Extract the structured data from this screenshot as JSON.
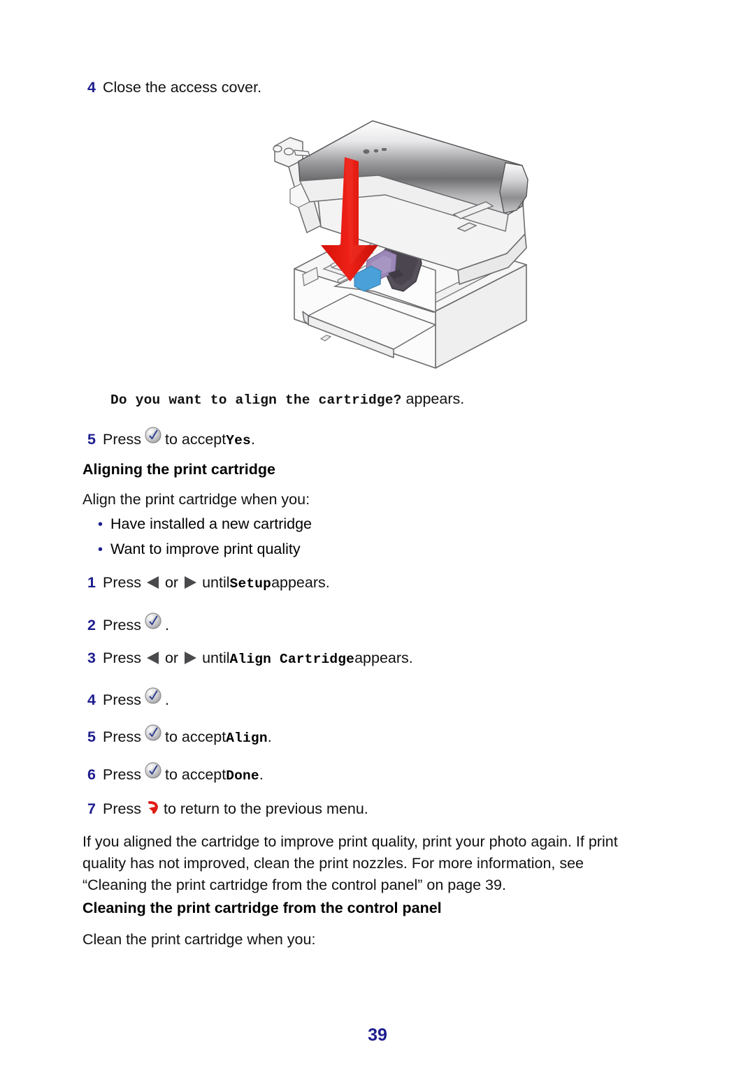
{
  "document": {
    "page_number": "39",
    "page_background": "#ffffff",
    "accent_color": "#1d1d8f",
    "arrow_color": "#e01b13"
  },
  "step4": {
    "number": "4",
    "text": "Close the access cover."
  },
  "illustration": {
    "name": "all-in-one-printer-closing-access-cover",
    "description": "Line drawing of an all-in-one inkjet printer with the scanner access cover raised, a large red downward arrow indicating to close it, and the print cartridge carrier visible inside.",
    "arrow_color": "#e01b13",
    "body_color": "#f2f2f2",
    "outline_color": "#58585a",
    "lid_gradient": [
      "#ffffff",
      "#b9b9bb",
      "#6e6e70",
      "#d9d9db"
    ],
    "cartridge_colors": {
      "carrier": "#4f4a52",
      "color_cartridge": "#9b87b8",
      "black_cartridge": "#4aa0d8"
    }
  },
  "prompt_line": {
    "display_text": "Do you want to align the cartridge?",
    "suffix": " appears."
  },
  "step5_top": {
    "number": "5",
    "before_icon": "Press ",
    "icon": "select-button-icon",
    "after_icon": " to accept ",
    "display_value": "Yes",
    "trailing": "."
  },
  "section_align": {
    "heading": "Aligning the print cartridge",
    "intro": "Align the print cartridge when you:",
    "bullets": [
      "Have installed a new cartridge",
      "Want to improve print quality"
    ],
    "steps": [
      {
        "number": "1",
        "before": "Press ",
        "icon_left": "left-arrow-icon",
        "between": " or ",
        "icon_right": "right-arrow-icon",
        "after": " until ",
        "display_value": "Setup",
        "trailing": " appears."
      },
      {
        "number": "2",
        "before": "Press ",
        "icon": "select-button-icon",
        "trailing": "."
      },
      {
        "number": "3",
        "before": "Press ",
        "icon_left": "left-arrow-icon",
        "between": " or ",
        "icon_right": "right-arrow-icon",
        "after": " until ",
        "display_value": "Align Cartridge",
        "trailing": " appears."
      },
      {
        "number": "4",
        "before": "Press ",
        "icon": "select-button-icon",
        "trailing": "."
      },
      {
        "number": "5",
        "before": "Press ",
        "icon": "select-button-icon",
        "after": " to accept ",
        "display_value": "Align",
        "trailing": "."
      },
      {
        "number": "6",
        "before": "Press ",
        "icon": "select-button-icon",
        "after": " to accept ",
        "display_value": "Done",
        "trailing": "."
      },
      {
        "number": "7",
        "before": "Press ",
        "icon": "back-button-icon",
        "after": " to return to the previous menu.",
        "trailing": ""
      }
    ]
  },
  "closing_paragraph": {
    "line1": "If you aligned the cartridge to improve print quality, print your photo again. If print",
    "line2": "quality has not improved, clean the print nozzles. For more information, see",
    "line3": "“Cleaning the print cartridge from the control panel” on page 39."
  },
  "section_clean": {
    "heading": "Cleaning the print cartridge from the control panel",
    "intro": "Clean the print cartridge when you:"
  }
}
